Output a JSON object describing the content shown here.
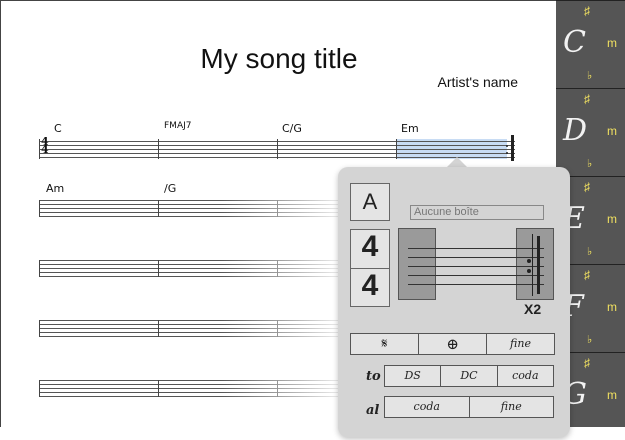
{
  "song": {
    "title": "My song title",
    "artist": "Artist's name",
    "time_signature": {
      "top": "4",
      "bottom": "4"
    },
    "rows": [
      [
        "C",
        "FMAJ7",
        "C/G",
        "Em"
      ],
      [
        "Am",
        "/G",
        "",
        ""
      ],
      [
        "",
        "",
        "",
        ""
      ],
      [
        "",
        "",
        "",
        ""
      ],
      [
        "",
        "",
        "",
        ""
      ]
    ],
    "selected_bar": "Em"
  },
  "keys": [
    {
      "letter": "C",
      "sharp": "♯",
      "flat": "♭",
      "minor": "m"
    },
    {
      "letter": "D",
      "sharp": "♯",
      "flat": "♭",
      "minor": "m"
    },
    {
      "letter": "E",
      "sharp": "♯",
      "flat": "♭",
      "minor": "m"
    },
    {
      "letter": "F",
      "sharp": "♯",
      "flat": "♭",
      "minor": "m"
    },
    {
      "letter": "G",
      "sharp": "♯",
      "flat": "♭",
      "minor": "m"
    }
  ],
  "popover": {
    "section_label": "A",
    "time_top": "4",
    "time_bottom": "4",
    "box_placeholder": "Aucune boîte",
    "repeat_count": "X2",
    "markers": [
      "𝄋",
      "⊕",
      "fine"
    ],
    "to_label": "to",
    "to_options": [
      "DS",
      "DC",
      "coda"
    ],
    "al_label": "al",
    "al_options": [
      "coda",
      "fine"
    ]
  },
  "colors": {
    "selected_bar": "#c8dcf4",
    "accent": "#f0e060",
    "strip": "#555555"
  }
}
